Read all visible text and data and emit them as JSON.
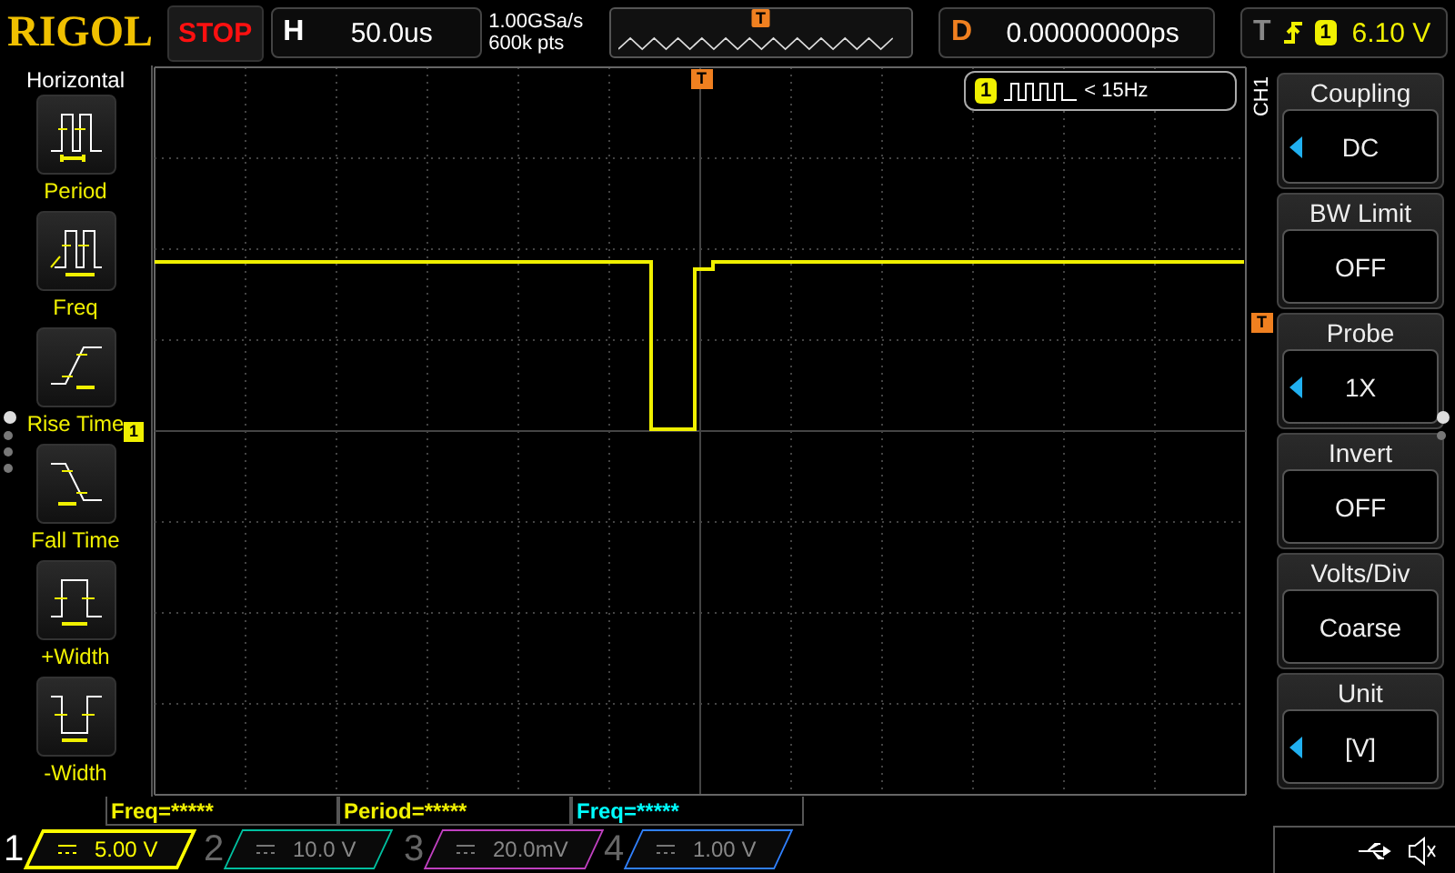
{
  "brand": "RIGOL",
  "run_state": "STOP",
  "horizontal": {
    "label": "H",
    "value": "50.0us"
  },
  "sample_rate": "1.00GSa/s",
  "memory_depth": "600k pts",
  "overview_marker": "T",
  "delay": {
    "label": "D",
    "value": "0.00000000ps"
  },
  "trigger": {
    "label": "T",
    "channel": "1",
    "level": "6.10 V"
  },
  "left_menu": {
    "title": "Horizontal",
    "items": [
      {
        "kind": "period",
        "label": "Period"
      },
      {
        "kind": "freq",
        "label": "Freq"
      },
      {
        "kind": "rise",
        "label": "Rise Time"
      },
      {
        "kind": "fall",
        "label": "Fall Time"
      },
      {
        "kind": "pwidth",
        "label": "+Width"
      },
      {
        "kind": "nwidth",
        "label": "-Width"
      }
    ],
    "pages": [
      {
        "selected": true
      },
      {
        "selected": false
      },
      {
        "selected": false
      },
      {
        "selected": false
      }
    ]
  },
  "markers": {
    "trigger_position": "T",
    "channel": "1",
    "trigger_level": "T"
  },
  "freq_counter": {
    "channel": "1",
    "text": "< 15Hz"
  },
  "right_menu": {
    "tab": "CH1",
    "items": [
      {
        "title": "Coupling",
        "value": "DC",
        "adjustable": true
      },
      {
        "title": "BW Limit",
        "value": "OFF",
        "adjustable": false
      },
      {
        "title": "Probe",
        "value": "1X",
        "adjustable": true
      },
      {
        "title": "Invert",
        "value": "OFF",
        "adjustable": false
      },
      {
        "title": "Volts/Div",
        "value": "Coarse",
        "adjustable": false
      },
      {
        "title": "Unit",
        "value": "[V]",
        "adjustable": true
      }
    ],
    "pages": [
      {
        "selected": true
      },
      {
        "selected": false
      }
    ]
  },
  "measurements": [
    {
      "text": "Freq=*****",
      "color": "#f0f000"
    },
    {
      "text": "Period=*****",
      "color": "#f0f000"
    },
    {
      "text": "Freq=*****",
      "color": "#00ffff"
    }
  ],
  "channels": [
    {
      "number": "1",
      "scale": "5.00 V",
      "on": true,
      "color": "#ffff00"
    },
    {
      "number": "2",
      "scale": "10.0 V",
      "on": false,
      "color": "#00c0a0"
    },
    {
      "number": "3",
      "scale": "20.0mV",
      "on": false,
      "color": "#c040c0"
    },
    {
      "number": "4",
      "scale": "1.00 V",
      "on": false,
      "color": "#3080ff"
    }
  ]
}
